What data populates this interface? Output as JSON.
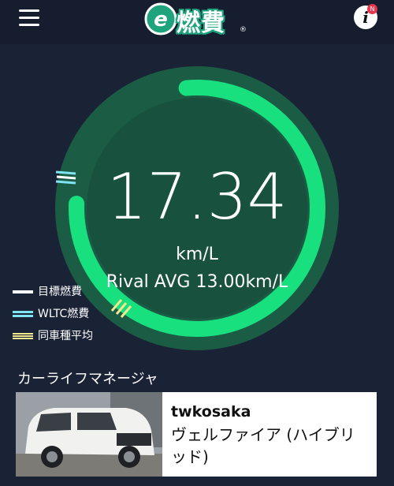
{
  "header": {
    "logo_text": "燃費",
    "logo_reg": "®",
    "info_label": "i",
    "info_badge": "N"
  },
  "gauge": {
    "reading": "17.34",
    "unit": "km/L",
    "rival_text": "Rival AVG 13.00km/L",
    "progress_color": "#19e07f",
    "ring_bg_color": "#1b5c45",
    "inner_color": "#19513f"
  },
  "legend": {
    "items": [
      {
        "label": "目標燃費",
        "color": "#ffffff"
      },
      {
        "label": "WLTC燃費",
        "color": "#7fe3f2"
      },
      {
        "label": "同車種平均",
        "color": "#f2e890"
      }
    ]
  },
  "section": {
    "title": "カーライフマネージャ"
  },
  "card": {
    "user": "twkosaka",
    "car": "ヴェルファイア (ハイブリッド)"
  }
}
